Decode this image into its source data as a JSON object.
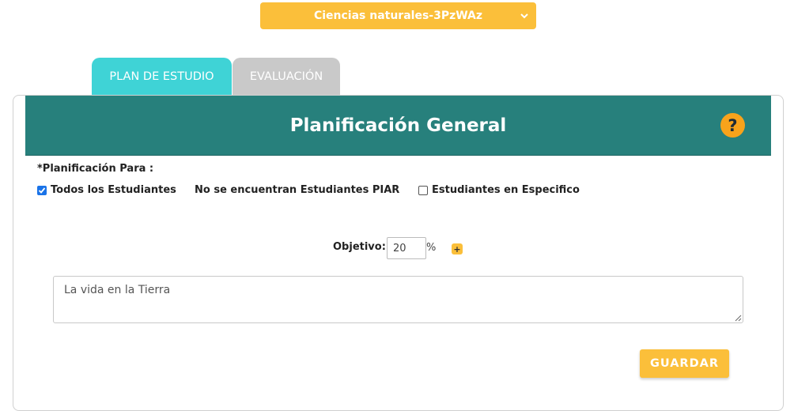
{
  "subject_select": {
    "value": "Ciencias naturales-3PzWAz",
    "icon": "chevron-down-icon"
  },
  "tabs": [
    {
      "label": "PLAN DE ESTUDIO",
      "active": true
    },
    {
      "label": "EVALUACIÓN",
      "active": false
    }
  ],
  "banner": {
    "title": "Planificación General",
    "help_icon": "?"
  },
  "planning": {
    "label": "*Planificación Para :",
    "options": [
      {
        "label": "Todos los Estudiantes",
        "checked": true
      },
      {
        "label": "No se encuentran Estudiantes PIAR"
      },
      {
        "label": "Estudiantes en Especifico",
        "checked": false
      }
    ]
  },
  "objective": {
    "label": "Objetivo:",
    "value": "20",
    "unit": "%",
    "add_label": "+",
    "text": "La vida en la Tierra"
  },
  "actions": {
    "save_label": "GUARDAR"
  },
  "colors": {
    "accent": "#fbbf3a",
    "banner": "#27807c",
    "tab_active": "#3fd3d6",
    "tab_inactive": "#c9c9c9",
    "help": "#f8a31b"
  }
}
